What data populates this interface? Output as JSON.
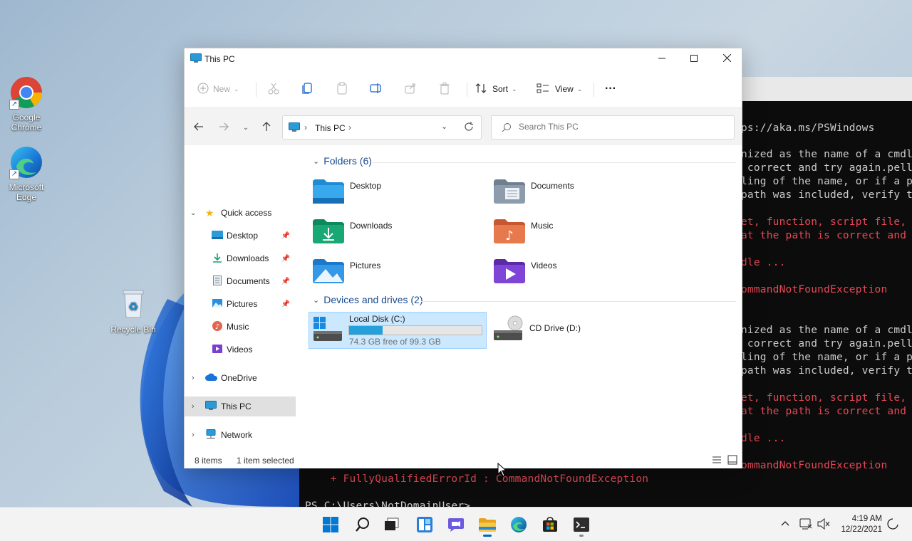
{
  "desktop": {
    "icons": [
      {
        "label": "Google Chrome",
        "icon": "chrome-icon"
      },
      {
        "label": "Microsoft Edge",
        "icon": "edge-icon"
      },
      {
        "label": "Recycle Bin",
        "icon": "recycle-bin-icon"
      }
    ]
  },
  "terminal": {
    "lines": [
      {
        "text": "ps://aka.ms/PSWindows",
        "color": "white"
      },
      {
        "text": "nized as the name of a cmdl",
        "color": "white"
      },
      {
        "text": " correct and try again.pell",
        "color": "white"
      },
      {
        "text": "ling of the name, or if a p",
        "color": "white"
      },
      {
        "text": "path was included, verify t",
        "color": "white"
      },
      {
        "text": "et, function, script file,",
        "color": "red"
      },
      {
        "text": "at the path is correct and",
        "color": "red"
      },
      {
        "text": "dle ...",
        "color": "red"
      },
      {
        "text": "ommandNotFoundException",
        "color": "red"
      },
      {
        "text": "nized as the name of a cmdl",
        "color": "white"
      },
      {
        "text": " correct and try again.pell",
        "color": "white"
      },
      {
        "text": "ling of the name, or if a p",
        "color": "white"
      },
      {
        "text": "path was included, verify t",
        "color": "white"
      },
      {
        "text": "et, function, script file,",
        "color": "red"
      },
      {
        "text": "at the path is correct and",
        "color": "red"
      },
      {
        "text": "dle ...",
        "color": "red"
      },
      {
        "text": "ommandNotFoundException",
        "color": "red"
      },
      {
        "text": "    + FullyQualifiedErrorId : CommandNotFoundException",
        "color": "red"
      },
      {
        "text": "PS C:\\Users\\NotDomainUser>",
        "color": "white"
      }
    ]
  },
  "explorer": {
    "title": "This PC",
    "toolbar": {
      "new_label": "New",
      "sort_label": "Sort",
      "view_label": "View",
      "more_label": "···"
    },
    "address": {
      "location": "This PC",
      "search_placeholder": "Search This PC"
    },
    "nav": {
      "quick_access": "Quick access",
      "pinned": [
        {
          "label": "Desktop",
          "icon": "desktop-folder-icon",
          "pinned": true
        },
        {
          "label": "Downloads",
          "icon": "downloads-icon",
          "pinned": true
        },
        {
          "label": "Documents",
          "icon": "documents-icon",
          "pinned": true
        },
        {
          "label": "Pictures",
          "icon": "pictures-icon",
          "pinned": true
        },
        {
          "label": "Music",
          "icon": "music-icon",
          "pinned": false
        },
        {
          "label": "Videos",
          "icon": "videos-icon",
          "pinned": false
        }
      ],
      "onedrive": "OneDrive",
      "this_pc": "This PC",
      "network": "Network"
    },
    "folders_header": "Folders (6)",
    "folders": [
      {
        "label": "Desktop",
        "icon": "desktop-folder-icon"
      },
      {
        "label": "Documents",
        "icon": "documents-folder-icon"
      },
      {
        "label": "Downloads",
        "icon": "downloads-folder-icon"
      },
      {
        "label": "Music",
        "icon": "music-folder-icon"
      },
      {
        "label": "Pictures",
        "icon": "pictures-folder-icon"
      },
      {
        "label": "Videos",
        "icon": "videos-folder-icon"
      }
    ],
    "drives_header": "Devices and drives (2)",
    "drives": [
      {
        "label": "Local Disk (C:)",
        "free_text": "74.3 GB free of 99.3 GB",
        "used_fraction": 0.252,
        "selected": true
      },
      {
        "label": "CD Drive (D:)",
        "free_text": "",
        "selected": false
      }
    ],
    "status": {
      "item_count": "8 items",
      "selection": "1 item selected"
    }
  },
  "taskbar": {
    "apps": [
      "start-icon",
      "search-icon",
      "task-view-icon",
      "widgets-icon",
      "chat-icon",
      "file-explorer-icon",
      "edge-icon",
      "store-icon",
      "terminal-icon"
    ],
    "time": "4:19 AM",
    "date": "12/22/2021"
  },
  "colors": {
    "accent": "#0067c0",
    "folder_header": "#1a4d8f",
    "selection": "#cce8ff",
    "error_red": "#e74856"
  }
}
